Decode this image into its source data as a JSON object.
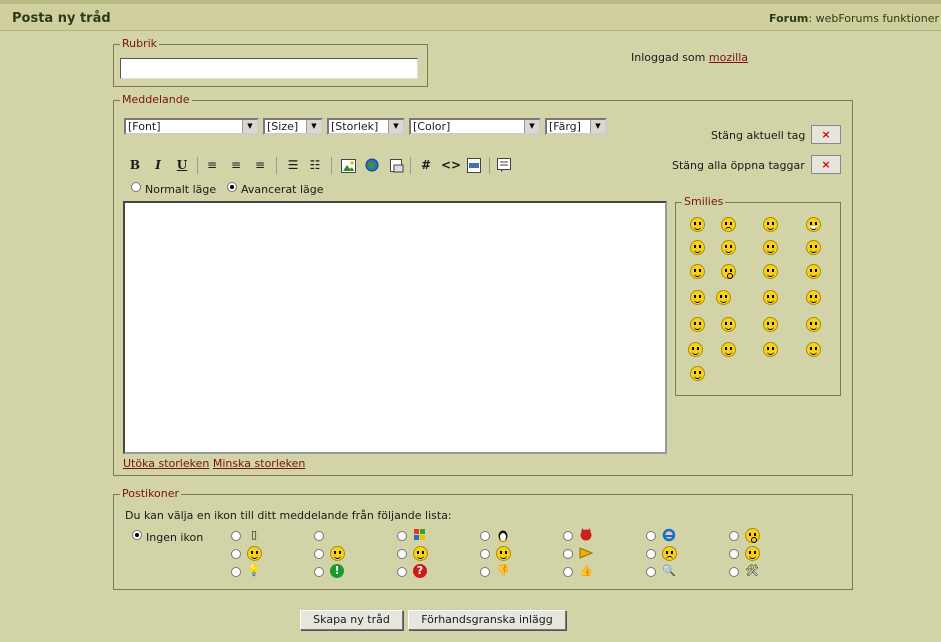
{
  "header": {
    "title": "Posta ny tråd",
    "forum_label": "Forum",
    "forum_name": "webForums funktioner"
  },
  "subject": {
    "legend": "Rubrik",
    "value": ""
  },
  "login": {
    "prefix": "Inloggad som",
    "user": "mozilla"
  },
  "message": {
    "legend": "Meddelande",
    "selects": [
      "[Font]",
      "[Size]",
      "[Storlek]",
      "[Color]",
      "[Färg]"
    ],
    "close_current_tag": "Stäng aktuell tag",
    "close_all_tags": "Stäng alla öppna taggar",
    "close_symbol": "×",
    "mode_normal": "Normalt läge",
    "mode_advanced": "Avancerat läge",
    "toolbar": {
      "bold": "B",
      "italic": "I",
      "underline": "U",
      "hash": "#",
      "code": "<>"
    },
    "grow_link": "Utöka storleken",
    "shrink_link": "Minska storleken"
  },
  "smilies": {
    "legend": "Smilies"
  },
  "post_icons": {
    "legend": "Postikoner",
    "instruction": "Du kan välja en ikon till ditt meddelande från följande lista:",
    "no_icon": "Ingen ikon"
  },
  "buttons": {
    "create": "Skapa ny tråd",
    "preview": "Förhandsgranska inlägg"
  }
}
